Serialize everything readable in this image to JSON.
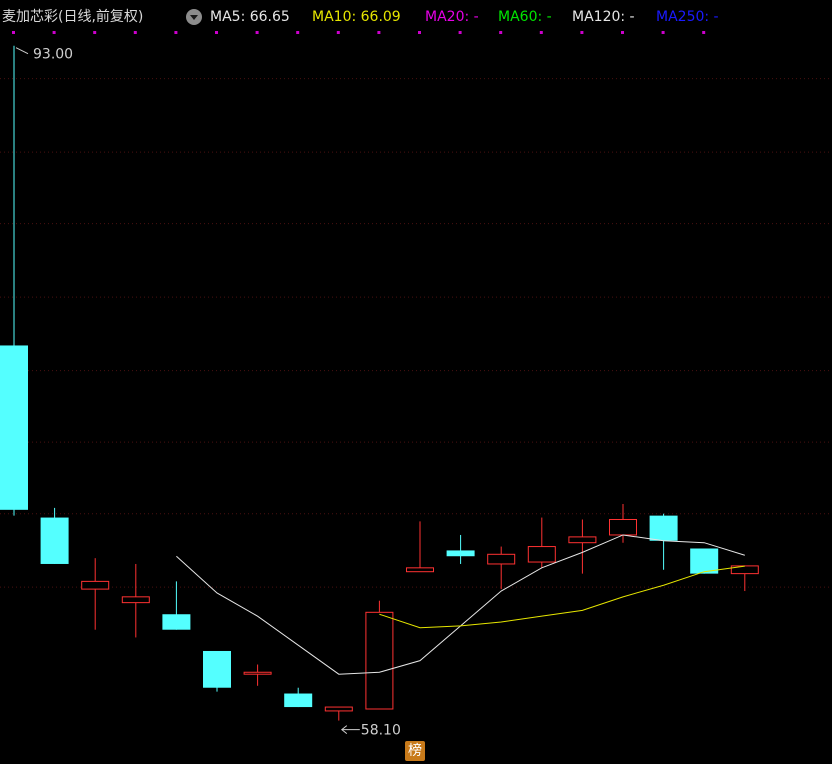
{
  "header": {
    "title": "麦加芯彩(日线,前复权)",
    "ma": [
      {
        "label": "MA5:",
        "value": "66.65",
        "color": "#e6e6e6"
      },
      {
        "label": "MA10:",
        "value": "66.09",
        "color": "#e6e600"
      },
      {
        "label": "MA20:",
        "value": "-",
        "color": "#e600e6"
      },
      {
        "label": "MA60:",
        "value": "-",
        "color": "#00e600"
      },
      {
        "label": "MA120:",
        "value": "-",
        "color": "#e6e6e6"
      },
      {
        "label": "MA250:",
        "value": "-",
        "color": "#1a1aff"
      }
    ]
  },
  "badge": "榜",
  "chart_data": {
    "type": "candlestick",
    "ylim": [
      57.2,
      93.4
    ],
    "gridlines": [
      65,
      68.8,
      72.5,
      76.2,
      80,
      83.8,
      87.5,
      91.3
    ],
    "high_label": "93.00",
    "low_label": "58.10",
    "candles": [
      {
        "o": 77.5,
        "c": 69.0,
        "h": 93.0,
        "l": 68.7
      },
      {
        "o": 68.6,
        "c": 66.2,
        "h": 69.1,
        "l": 66.2
      },
      {
        "o": 64.9,
        "c": 65.3,
        "h": 66.5,
        "l": 62.8
      },
      {
        "o": 64.2,
        "c": 64.5,
        "h": 66.2,
        "l": 62.4
      },
      {
        "o": 63.6,
        "c": 62.8,
        "h": 65.3,
        "l": 62.8
      },
      {
        "o": 61.7,
        "c": 59.8,
        "h": 61.7,
        "l": 59.6
      },
      {
        "o": 60.5,
        "c": 60.6,
        "h": 61.0,
        "l": 59.9
      },
      {
        "o": 59.5,
        "c": 58.8,
        "h": 59.8,
        "l": 58.8
      },
      {
        "o": 58.6,
        "c": 58.8,
        "h": 58.8,
        "l": 58.1
      },
      {
        "o": 58.7,
        "c": 63.7,
        "h": 64.3,
        "l": 58.7
      },
      {
        "o": 65.8,
        "c": 66.0,
        "h": 68.4,
        "l": 65.8
      },
      {
        "o": 66.9,
        "c": 66.6,
        "h": 67.7,
        "l": 66.2
      },
      {
        "o": 66.2,
        "c": 66.7,
        "h": 67.1,
        "l": 64.9
      },
      {
        "o": 66.3,
        "c": 67.1,
        "h": 68.6,
        "l": 66.0
      },
      {
        "o": 67.3,
        "c": 67.6,
        "h": 68.5,
        "l": 65.7
      },
      {
        "o": 67.7,
        "c": 68.5,
        "h": 69.3,
        "l": 67.3
      },
      {
        "o": 68.7,
        "c": 67.4,
        "h": 68.8,
        "l": 65.9
      },
      {
        "o": 67.0,
        "c": 65.7,
        "h": 67.0,
        "l": 65.7
      },
      {
        "o": 65.7,
        "c": 66.1,
        "h": 66.1,
        "l": 64.8
      }
    ],
    "ma5": [
      null,
      null,
      null,
      null,
      66.6,
      64.7,
      63.5,
      62.0,
      60.5,
      60.6,
      61.2,
      63.0,
      64.8,
      66.0,
      66.8,
      67.7,
      67.4,
      67.3,
      66.65
    ],
    "ma10": [
      null,
      null,
      null,
      null,
      null,
      null,
      null,
      null,
      null,
      63.6,
      62.9,
      63.0,
      63.2,
      63.5,
      63.8,
      64.5,
      65.1,
      65.8,
      66.09
    ],
    "colors": {
      "up": "#ff3232",
      "down": "#54ffff",
      "ma5": "#e6e6e6",
      "ma10": "#e6e600",
      "grid": "#4a1010",
      "annot": "#cfcfcf"
    }
  }
}
